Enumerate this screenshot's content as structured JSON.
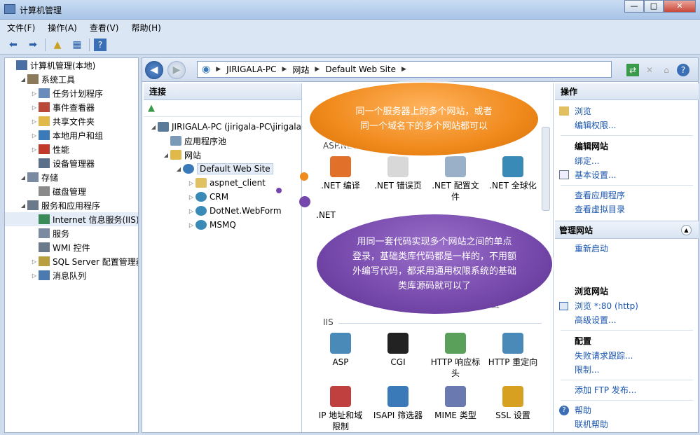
{
  "window": {
    "title": "计算机管理"
  },
  "menu": [
    "文件(F)",
    "操作(A)",
    "查看(V)",
    "帮助(H)"
  ],
  "tree": [
    {
      "label": "计算机管理(本地)",
      "level": 0,
      "arrow": "",
      "icon": "computer-management-icon",
      "color": "#4a6fa5"
    },
    {
      "label": "系统工具",
      "level": 1,
      "arrow": "◢",
      "icon": "system-tools-icon",
      "color": "#8a7a5a"
    },
    {
      "label": "任务计划程序",
      "level": 2,
      "arrow": "▷",
      "icon": "clock-icon",
      "color": "#6a8cba"
    },
    {
      "label": "事件查看器",
      "level": 2,
      "arrow": "▷",
      "icon": "event-viewer-icon",
      "color": "#b94a3a"
    },
    {
      "label": "共享文件夹",
      "level": 2,
      "arrow": "▷",
      "icon": "shared-folder-icon",
      "color": "#e0b94a"
    },
    {
      "label": "本地用户和组",
      "level": 2,
      "arrow": "▷",
      "icon": "users-icon",
      "color": "#3a7ab8"
    },
    {
      "label": "性能",
      "level": 2,
      "arrow": "▷",
      "icon": "performance-icon",
      "color": "#c0392b"
    },
    {
      "label": "设备管理器",
      "level": 2,
      "arrow": "",
      "icon": "device-manager-icon",
      "color": "#5a6f8a"
    },
    {
      "label": "存储",
      "level": 1,
      "arrow": "◢",
      "icon": "storage-icon",
      "color": "#7a8aa0"
    },
    {
      "label": "磁盘管理",
      "level": 2,
      "arrow": "",
      "icon": "disk-icon",
      "color": "#8a8a8a"
    },
    {
      "label": "服务和应用程序",
      "level": 1,
      "arrow": "◢",
      "icon": "services-apps-icon",
      "color": "#6a7a8a"
    },
    {
      "label": "Internet 信息服务(IIS)管",
      "level": 2,
      "arrow": "",
      "icon": "iis-icon",
      "color": "#3a8a5a",
      "selected": true
    },
    {
      "label": "服务",
      "level": 2,
      "arrow": "",
      "icon": "services-icon",
      "color": "#7a8aa0"
    },
    {
      "label": "WMI 控件",
      "level": 2,
      "arrow": "",
      "icon": "wmi-icon",
      "color": "#6a7a8a"
    },
    {
      "label": "SQL Server 配置管理器",
      "level": 2,
      "arrow": "▷",
      "icon": "sql-server-icon",
      "color": "#b8a040"
    },
    {
      "label": "消息队列",
      "level": 2,
      "arrow": "▷",
      "icon": "message-queue-icon",
      "color": "#4a7ab0"
    }
  ],
  "address": {
    "parts": [
      "JIRIGALA-PC",
      "网站",
      "Default Web Site"
    ]
  },
  "connections": {
    "title": "连接",
    "items": [
      {
        "label": "JIRIGALA-PC (jirigala-PC\\jirigala",
        "level": 0,
        "arrow": "◢",
        "icon": "server-icon",
        "color": "#5a7a9a"
      },
      {
        "label": "应用程序池",
        "level": 1,
        "arrow": "",
        "icon": "app-pool-icon",
        "color": "#7a9ab8"
      },
      {
        "label": "网站",
        "level": 1,
        "arrow": "◢",
        "icon": "sites-folder-icon",
        "color": "#e0b94a"
      },
      {
        "label": "Default Web Site",
        "level": 2,
        "arrow": "◢",
        "icon": "globe-icon",
        "color": "#3a7ab8",
        "selected": true
      },
      {
        "label": "aspnet_client",
        "level": 3,
        "arrow": "▷",
        "icon": "folder-icon",
        "color": "#e0c060"
      },
      {
        "label": "CRM",
        "level": 3,
        "arrow": "▷",
        "icon": "web-app-icon",
        "color": "#3a8ab8"
      },
      {
        "label": "DotNet.WebForm",
        "level": 3,
        "arrow": "▷",
        "icon": "web-app-icon",
        "color": "#3a8ab8"
      },
      {
        "label": "MSMQ",
        "level": 3,
        "arrow": "▷",
        "icon": "web-app-icon",
        "color": "#3a8ab8"
      }
    ]
  },
  "features": {
    "section_aspnet": "ASP.NET",
    "section_iis": "IIS",
    "aspnet": [
      {
        "label": ".NET 编译",
        "icon": "net-compile-icon",
        "color": "#e0702a"
      },
      {
        "label": ".NET 错误页",
        "icon": "error-404-icon",
        "color": "#d8d8d8"
      },
      {
        "label": ".NET 配置文件",
        "icon": "net-profile-icon",
        "color": "#9ab0c8"
      },
      {
        "label": ".NET 全球化",
        "icon": "globe-icon",
        "color": "#3a8ab8"
      }
    ],
    "row2_partial": ".NET",
    "row3_partial": "置",
    "iis": [
      {
        "label": "ASP",
        "icon": "asp-icon",
        "color": "#4a8ab8"
      },
      {
        "label": "CGI",
        "icon": "cgi-icon",
        "color": "#222222"
      },
      {
        "label": "HTTP 响应标头",
        "icon": "http-headers-icon",
        "color": "#5aa05a"
      },
      {
        "label": "HTTP 重定向",
        "icon": "http-redirect-icon",
        "color": "#4a8ab8"
      },
      {
        "label": "IP 地址和域限制",
        "icon": "ip-restrictions-icon",
        "color": "#c04040"
      },
      {
        "label": "ISAPI 筛选器",
        "icon": "isapi-icon",
        "color": "#3a7ab8"
      },
      {
        "label": "MIME 类型",
        "icon": "mime-icon",
        "color": "#6a7ab0"
      },
      {
        "label": "SSL 设置",
        "icon": "lock-icon",
        "color": "#d8a020"
      }
    ]
  },
  "actions": {
    "title": "操作",
    "top": [
      {
        "label": "浏览",
        "icon": "explore-icon"
      },
      {
        "label": "编辑权限...",
        "icon": ""
      }
    ],
    "edit_site_head": "编辑网站",
    "edit_site": [
      {
        "label": "绑定...",
        "icon": ""
      },
      {
        "label": "基本设置...",
        "icon": "settings-icon"
      }
    ],
    "view": [
      {
        "label": "查看应用程序",
        "icon": ""
      },
      {
        "label": "查看虚拟目录",
        "icon": ""
      }
    ],
    "manage_title": "管理网站",
    "restart": "重新启动",
    "browse_head": "浏览网站",
    "browse_link": "浏览 *:80 (http)",
    "advanced": "高级设置...",
    "config_head": "配置",
    "config": [
      "失败请求跟踪...",
      "限制...",
      "添加 FTP 发布..."
    ],
    "help": "帮助",
    "online_help": "联机帮助"
  },
  "callouts": {
    "orange": "同一个服务器上的多个网站，或者\n同一个域名下的多个网站都可以",
    "purple": "用同一套代码实现多个网站之间的单点\n登录，基础类库代码都是一样的，不用额\n外编写代码，都采用通用权限系统的基础\n类库源码就可以了"
  },
  "colors": {
    "accent": "#1a56b0",
    "orange": "#f08a1c",
    "purple": "#7548ab"
  }
}
